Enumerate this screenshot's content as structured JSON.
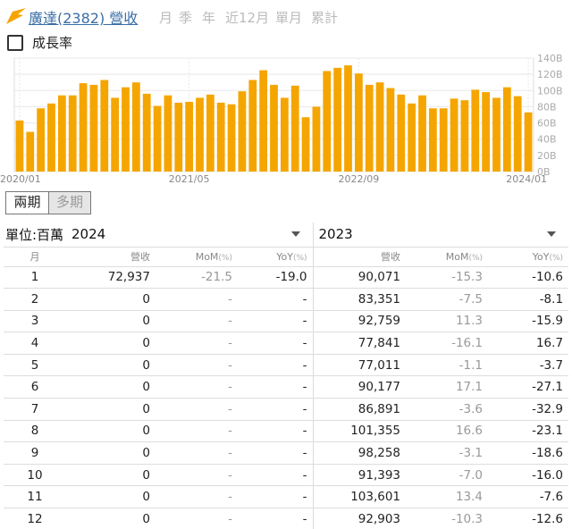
{
  "header": {
    "title": "廣達(2382) 營收",
    "periods": [
      {
        "label": "月",
        "active": true
      },
      {
        "label": "季",
        "active": false
      },
      {
        "label": "年",
        "active": false
      },
      {
        "label": "近12月",
        "active": false
      },
      {
        "label": "單月",
        "active": true
      },
      {
        "label": "累計",
        "active": false
      }
    ]
  },
  "growth_rate": {
    "label": "成長率",
    "checked": false
  },
  "chart_data": {
    "type": "bar",
    "bar_color": "#f5a500",
    "grid": true,
    "y_axis_position": "right",
    "ylim": [
      0,
      140
    ],
    "yticks": [
      "0B",
      "20B",
      "40B",
      "60B",
      "80B",
      "100B",
      "120B",
      "140B"
    ],
    "xtick_labels": [
      "2020/01",
      "2021/05",
      "2022/09",
      "2024/01"
    ],
    "values": [
      63,
      49,
      78,
      84,
      94,
      94,
      109,
      107,
      113,
      91,
      104,
      110,
      96,
      81,
      94,
      85,
      86,
      91,
      95,
      85,
      83,
      99,
      113,
      125,
      107,
      91,
      106,
      67,
      80,
      124,
      128,
      131,
      121,
      107,
      110,
      103,
      95,
      84,
      94,
      78,
      78,
      90,
      88,
      101,
      98,
      91,
      104,
      93,
      73
    ]
  },
  "toggle": {
    "two_period": "兩期",
    "multi_period": "多期"
  },
  "table": {
    "unit": "單位:百萬",
    "year_left": "2024",
    "year_right": "2023",
    "col_month": "月",
    "col_rev": "營收",
    "col_mom": "MoM",
    "col_yoy": "YoY",
    "pct": "(%)",
    "rows": [
      {
        "m": "1",
        "a_rev": "72,937",
        "a_mom": "-21.5",
        "a_yoy": "-19.0",
        "b_rev": "90,071",
        "b_mom": "-15.3",
        "b_yoy": "-10.6"
      },
      {
        "m": "2",
        "a_rev": "0",
        "a_mom": "-",
        "a_yoy": "-",
        "b_rev": "83,351",
        "b_mom": "-7.5",
        "b_yoy": "-8.1"
      },
      {
        "m": "3",
        "a_rev": "0",
        "a_mom": "-",
        "a_yoy": "-",
        "b_rev": "92,759",
        "b_mom": "11.3",
        "b_yoy": "-15.9"
      },
      {
        "m": "4",
        "a_rev": "0",
        "a_mom": "-",
        "a_yoy": "-",
        "b_rev": "77,841",
        "b_mom": "-16.1",
        "b_yoy": "16.7"
      },
      {
        "m": "5",
        "a_rev": "0",
        "a_mom": "-",
        "a_yoy": "-",
        "b_rev": "77,011",
        "b_mom": "-1.1",
        "b_yoy": "-3.7"
      },
      {
        "m": "6",
        "a_rev": "0",
        "a_mom": "-",
        "a_yoy": "-",
        "b_rev": "90,177",
        "b_mom": "17.1",
        "b_yoy": "-27.1"
      },
      {
        "m": "7",
        "a_rev": "0",
        "a_mom": "-",
        "a_yoy": "-",
        "b_rev": "86,891",
        "b_mom": "-3.6",
        "b_yoy": "-32.9"
      },
      {
        "m": "8",
        "a_rev": "0",
        "a_mom": "-",
        "a_yoy": "-",
        "b_rev": "101,355",
        "b_mom": "16.6",
        "b_yoy": "-23.1"
      },
      {
        "m": "9",
        "a_rev": "0",
        "a_mom": "-",
        "a_yoy": "-",
        "b_rev": "98,258",
        "b_mom": "-3.1",
        "b_yoy": "-18.6"
      },
      {
        "m": "10",
        "a_rev": "0",
        "a_mom": "-",
        "a_yoy": "-",
        "b_rev": "91,393",
        "b_mom": "-7.0",
        "b_yoy": "-16.0"
      },
      {
        "m": "11",
        "a_rev": "0",
        "a_mom": "-",
        "a_yoy": "-",
        "b_rev": "103,601",
        "b_mom": "13.4",
        "b_yoy": "-7.6"
      },
      {
        "m": "12",
        "a_rev": "0",
        "a_mom": "-",
        "a_yoy": "-",
        "b_rev": "92,903",
        "b_mom": "-10.3",
        "b_yoy": "-12.6"
      }
    ]
  }
}
